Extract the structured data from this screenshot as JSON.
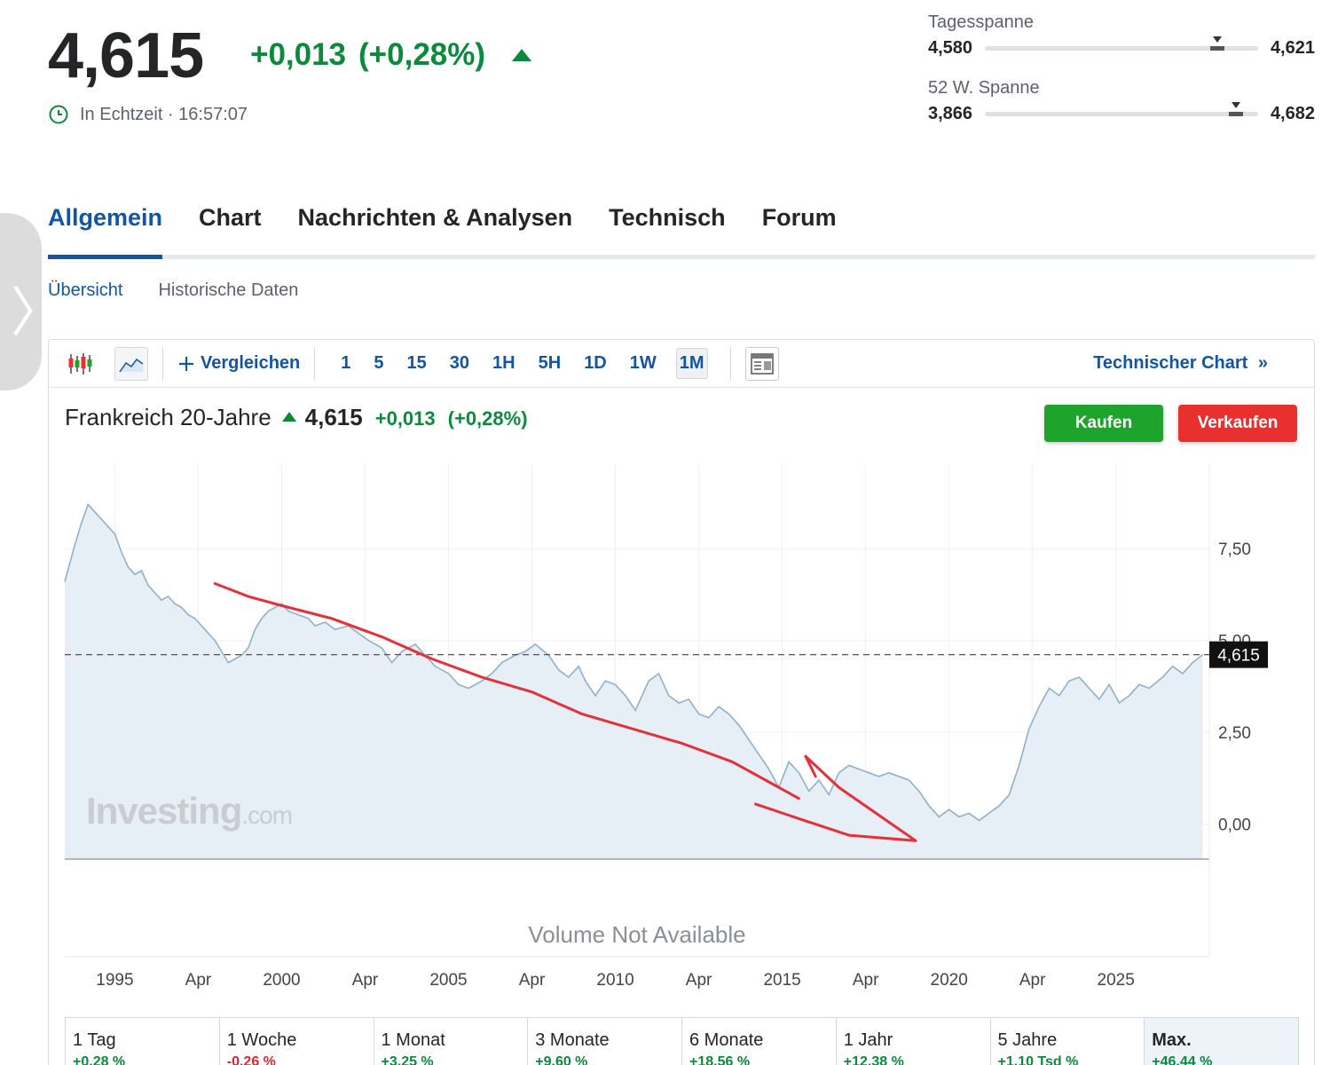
{
  "quote": {
    "price": "4,615",
    "change": "+0,013",
    "change_pct": "(+0,28%)",
    "realtime_label": "In Echtzeit · 16:57:07"
  },
  "ranges": {
    "day": {
      "label": "Tagesspanne",
      "low": "4,580",
      "high": "4,621",
      "position": 0.85
    },
    "week52": {
      "label": "52 W. Spanne",
      "low": "3,866",
      "high": "4,682",
      "position": 0.92
    }
  },
  "main_tabs": [
    {
      "label": "Allgemein",
      "active": true
    },
    {
      "label": "Chart",
      "active": false
    },
    {
      "label": "Nachrichten & Analysen",
      "active": false
    },
    {
      "label": "Technisch",
      "active": false
    },
    {
      "label": "Forum",
      "active": false
    }
  ],
  "sub_tabs": [
    {
      "label": "Übersicht",
      "active": true
    },
    {
      "label": "Historische Daten",
      "active": false
    }
  ],
  "toolbar": {
    "compare_label": "Vergleichen",
    "intervals": [
      "1",
      "5",
      "15",
      "30",
      "1H",
      "5H",
      "1D",
      "1W",
      "1M"
    ],
    "active_interval": "1M",
    "technical_chart_label": "Technischer Chart",
    "technical_chart_arrow": "»"
  },
  "instrument": {
    "name": "Frankreich 20-Jahre",
    "price": "4,615",
    "change": "+0,013",
    "change_pct": "(+0,28%)",
    "buy_label": "Kaufen",
    "sell_label": "Verkaufen"
  },
  "colors": {
    "accent": "#1256a0",
    "positive": "#0b8a3d",
    "negative": "#d9262e",
    "buy": "#1ea32c",
    "sell": "#e8302f",
    "line": "#8fb0c9",
    "area": "#e6eef6",
    "annotation": "#e5303a"
  },
  "chart_data": {
    "type": "area",
    "x": [
      1993.5,
      1993.8,
      1994.0,
      1994.2,
      1994.4,
      1994.6,
      1994.8,
      1995.0,
      1995.2,
      1995.4,
      1995.6,
      1995.8,
      1996.0,
      1996.2,
      1996.4,
      1996.6,
      1996.8,
      1997.0,
      1997.2,
      1997.4,
      1997.6,
      1997.8,
      1998.0,
      1998.2,
      1998.4,
      1998.6,
      1998.8,
      1999.0,
      1999.2,
      1999.4,
      1999.6,
      1999.8,
      2000.0,
      2000.2,
      2000.5,
      2000.8,
      2001.0,
      2001.3,
      2001.6,
      2002.0,
      2002.3,
      2002.6,
      2003.0,
      2003.3,
      2003.6,
      2004.0,
      2004.3,
      2004.6,
      2005.0,
      2005.3,
      2005.6,
      2006.0,
      2006.3,
      2006.6,
      2007.0,
      2007.3,
      2007.6,
      2008.0,
      2008.3,
      2008.6,
      2008.9,
      2009.1,
      2009.4,
      2009.7,
      2010.0,
      2010.3,
      2010.6,
      2011.0,
      2011.3,
      2011.6,
      2011.9,
      2012.2,
      2012.5,
      2012.8,
      2013.1,
      2013.4,
      2013.7,
      2014.0,
      2014.3,
      2014.6,
      2014.9,
      2015.2,
      2015.5,
      2015.8,
      2016.1,
      2016.4,
      2016.7,
      2017.0,
      2017.3,
      2017.6,
      2017.9,
      2018.2,
      2018.5,
      2018.8,
      2019.1,
      2019.4,
      2019.7,
      2020.0,
      2020.3,
      2020.6,
      2020.9,
      2021.2,
      2021.5,
      2021.8,
      2022.1,
      2022.4,
      2022.7,
      2023.0,
      2023.3,
      2023.6,
      2023.9,
      2024.2,
      2024.5,
      2024.8,
      2025.1,
      2025.4,
      2025.7,
      2026.0,
      2026.4,
      2026.7,
      2027.0,
      2027.3,
      2027.6
    ],
    "values": [
      6.6,
      7.6,
      8.2,
      8.7,
      8.5,
      8.3,
      8.1,
      7.9,
      7.4,
      7.0,
      6.8,
      6.9,
      6.5,
      6.3,
      6.1,
      6.2,
      6.0,
      5.9,
      5.7,
      5.6,
      5.4,
      5.2,
      5.0,
      4.7,
      4.4,
      4.5,
      4.6,
      4.8,
      5.3,
      5.6,
      5.8,
      5.9,
      6.0,
      5.8,
      5.7,
      5.6,
      5.4,
      5.5,
      5.3,
      5.4,
      5.2,
      5.0,
      4.8,
      4.4,
      4.7,
      4.9,
      4.6,
      4.3,
      4.1,
      3.8,
      3.7,
      3.9,
      4.1,
      4.4,
      4.6,
      4.7,
      4.9,
      4.6,
      4.2,
      4.0,
      4.3,
      3.9,
      3.5,
      3.9,
      3.8,
      3.5,
      3.1,
      3.9,
      4.1,
      3.5,
      3.3,
      3.4,
      3.0,
      2.9,
      3.2,
      3.0,
      2.7,
      2.3,
      1.9,
      1.5,
      1.0,
      1.7,
      1.4,
      0.9,
      1.2,
      0.8,
      1.4,
      1.6,
      1.5,
      1.4,
      1.3,
      1.4,
      1.3,
      1.2,
      0.9,
      0.5,
      0.2,
      0.4,
      0.2,
      0.3,
      0.1,
      0.3,
      0.5,
      0.8,
      1.6,
      2.6,
      3.2,
      3.7,
      3.5,
      3.9,
      4.0,
      3.7,
      3.4,
      3.8,
      3.3,
      3.5,
      3.8,
      3.7,
      4.0,
      4.3,
      4.1,
      4.4,
      4.615
    ],
    "xlim": [
      1993.5,
      2027.8
    ],
    "ylim": [
      -0.95,
      9.8
    ],
    "x_ticks": [
      {
        "value": 1995.0,
        "label": "1995"
      },
      {
        "value": 1997.5,
        "label": "Apr"
      },
      {
        "value": 2000.0,
        "label": "2000"
      },
      {
        "value": 2002.5,
        "label": "Apr"
      },
      {
        "value": 2005.0,
        "label": "2005"
      },
      {
        "value": 2007.5,
        "label": "Apr"
      },
      {
        "value": 2010.0,
        "label": "2010"
      },
      {
        "value": 2012.5,
        "label": "Apr"
      },
      {
        "value": 2015.0,
        "label": "2015"
      },
      {
        "value": 2017.5,
        "label": "Apr"
      },
      {
        "value": 2020.0,
        "label": "2020"
      },
      {
        "value": 2022.5,
        "label": "Apr"
      },
      {
        "value": 2025.0,
        "label": "2025"
      }
    ],
    "y_ticks": [
      {
        "value": 7.5,
        "label": "7,50"
      },
      {
        "value": 5.0,
        "label": "5,00"
      },
      {
        "value": 2.5,
        "label": "2,50"
      },
      {
        "value": 0.0,
        "label": "0,00"
      }
    ],
    "current_value": 4.615,
    "current_label": "4,615",
    "watermark_brand": "Investing",
    "watermark_suffix": ".com",
    "volume_label": "Volume Not Available",
    "grid": true,
    "annotations": [
      {
        "kind": "hand-drawn-line",
        "points": [
          [
            1998.0,
            6.55
          ],
          [
            1999.0,
            6.2
          ],
          [
            2000.0,
            5.95
          ],
          [
            2001.5,
            5.6
          ],
          [
            2003.0,
            5.1
          ],
          [
            2004.5,
            4.5
          ],
          [
            2006.0,
            4.0
          ],
          [
            2007.5,
            3.6
          ],
          [
            2009.0,
            3.0
          ],
          [
            2010.5,
            2.6
          ],
          [
            2012.0,
            2.2
          ],
          [
            2013.5,
            1.7
          ],
          [
            2014.5,
            1.2
          ],
          [
            2015.5,
            0.7
          ]
        ]
      },
      {
        "kind": "hand-drawn-arrowhead",
        "points": [
          [
            2014.2,
            0.55
          ],
          [
            2015.5,
            0.15
          ],
          [
            2017.0,
            -0.3
          ],
          [
            2019.0,
            -0.45
          ],
          [
            2016.7,
            1.0
          ],
          [
            2015.7,
            1.85
          ],
          [
            2016.0,
            1.3
          ]
        ]
      }
    ]
  },
  "performance": [
    {
      "label": "1 Tag",
      "value": "+0,28 %",
      "positive": true,
      "active": false
    },
    {
      "label": "1 Woche",
      "value": "-0,26 %",
      "positive": false,
      "active": false
    },
    {
      "label": "1 Monat",
      "value": "+3,25 %",
      "positive": true,
      "active": false
    },
    {
      "label": "3 Monate",
      "value": "+9,60 %",
      "positive": true,
      "active": false
    },
    {
      "label": "6 Monate",
      "value": "+18,56 %",
      "positive": true,
      "active": false
    },
    {
      "label": "1 Jahr",
      "value": "+12,38 %",
      "positive": true,
      "active": false
    },
    {
      "label": "5 Jahre",
      "value": "+1,10 Tsd %",
      "positive": true,
      "active": false
    },
    {
      "label": "Max.",
      "value": "+46,44 %",
      "positive": true,
      "active": true
    }
  ]
}
